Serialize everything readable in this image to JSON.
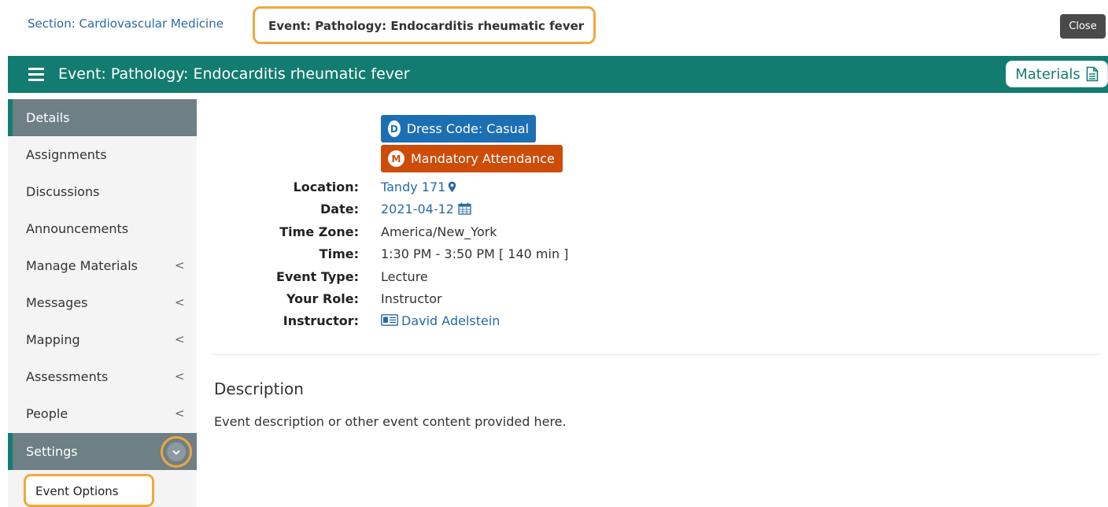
{
  "breadcrumb": {
    "section_link": "Section: Cardiovascular Medicine",
    "current": "Event: Pathology: Endocarditis rheumatic fever"
  },
  "toolbar": {
    "close_label": "Close"
  },
  "header": {
    "title": "Event: Pathology: Endocarditis rheumatic fever",
    "materials_label": "Materials",
    "background_color": "#137c70"
  },
  "sidebar": {
    "items": [
      {
        "label": "Details",
        "active": true,
        "has_chevron": false
      },
      {
        "label": "Assignments",
        "has_chevron": false
      },
      {
        "label": "Discussions",
        "has_chevron": false
      },
      {
        "label": "Announcements",
        "has_chevron": false
      },
      {
        "label": "Manage Materials",
        "has_chevron": true
      },
      {
        "label": "Messages",
        "has_chevron": true
      },
      {
        "label": "Mapping",
        "has_chevron": true
      },
      {
        "label": "Assessments",
        "has_chevron": true
      },
      {
        "label": "People",
        "has_chevron": true
      },
      {
        "label": "Settings",
        "active": true,
        "expanded": true
      }
    ],
    "chevron_glyph": "<",
    "settings_submenu": [
      {
        "label": "Event Options"
      }
    ]
  },
  "badges": {
    "dress_code": {
      "letter": "D",
      "label": "Dress Code: Casual",
      "color": "#1d6fb4"
    },
    "mandatory": {
      "letter": "M",
      "label": "Mandatory Attendance",
      "color": "#cc4c08"
    }
  },
  "details": {
    "location": {
      "label": "Location:",
      "value": "Tandy 171",
      "icon": "map-marker-icon"
    },
    "date": {
      "label": "Date:",
      "value": "2021-04-12",
      "icon": "calendar-icon"
    },
    "time_zone": {
      "label": "Time Zone:",
      "value": "America/New_York"
    },
    "time": {
      "label": "Time:",
      "value": "1:30 PM - 3:50 PM [ 140 min ]"
    },
    "event_type": {
      "label": "Event Type:",
      "value": "Lecture"
    },
    "your_role": {
      "label": "Your Role:",
      "value": "Instructor"
    },
    "instructor": {
      "label": "Instructor:",
      "value": "David Adelstein",
      "icon": "id-card-icon"
    }
  },
  "description": {
    "heading": "Description",
    "body": "Event description or other event content provided here."
  },
  "highlight_color": "#f0a83c"
}
